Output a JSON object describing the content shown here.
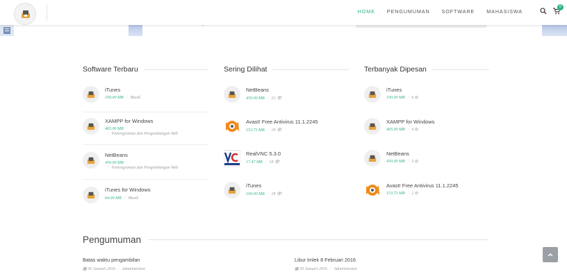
{
  "nav": {
    "items": [
      "HOME",
      "PENGUMUMAN",
      "SOFTWARE",
      "MAHASISWA"
    ],
    "active": "HOME",
    "cart_count": "0"
  },
  "hero": {
    "faded_title": "Recent Projects"
  },
  "columns": [
    {
      "title": "Software Terbaru",
      "items": [
        {
          "name": "iTunes",
          "size": "100.00 MB",
          "extra": "Musik"
        },
        {
          "name": "XAMPP for Windows",
          "size": "465.00 MB",
          "extra": "Pemrograman dan Pengembangan Web"
        },
        {
          "name": "NetBeans",
          "size": "450.00 MB",
          "extra": "Pemrograman dan Pengembangan Web"
        },
        {
          "name": "iTunes for Windows",
          "size": "64.00 MB",
          "extra": "Musik"
        }
      ]
    },
    {
      "title": "Sering Dilihat",
      "items": [
        {
          "name": "NetBeans",
          "size": "450.00 MB",
          "extra": "22",
          "icon": "generic"
        },
        {
          "name": "Avast! Free Antivirus 11.1.2245",
          "size": "153.73 MB",
          "extra": "19",
          "icon": "avast"
        },
        {
          "name": "RealVNC 5.3.0",
          "size": "17.47 MB",
          "extra": "18",
          "icon": "vnc"
        },
        {
          "name": "iTunes",
          "size": "100.00 MB",
          "extra": "18",
          "icon": "generic"
        }
      ]
    },
    {
      "title": "Terbanyak Dipesan",
      "items": [
        {
          "name": "iTunes",
          "size": "100.00 MB",
          "extra": "6",
          "icon": "generic"
        },
        {
          "name": "XAMPP for Windows",
          "size": "465.00 MB",
          "extra": "4",
          "icon": "generic"
        },
        {
          "name": "NetBeans",
          "size": "450.00 MB",
          "extra": "3",
          "icon": "generic"
        },
        {
          "name": "Avast! Free Antivirus 11.1.2245",
          "size": "153.73 MB",
          "extra": "2",
          "icon": "avast"
        }
      ]
    }
  ],
  "announcements": {
    "title": "Pengumuman",
    "items": [
      {
        "title": "Batas waktu pengambilan",
        "date": "30 Januari 2016",
        "author": "Administrator"
      },
      {
        "title": "Libur Imlek 8 Februari 2016",
        "date": "30 Januari 2016",
        "author": "Administrator"
      }
    ]
  },
  "colors": {
    "accent": "#2db08a",
    "icon_orange": "#e8a33d"
  }
}
